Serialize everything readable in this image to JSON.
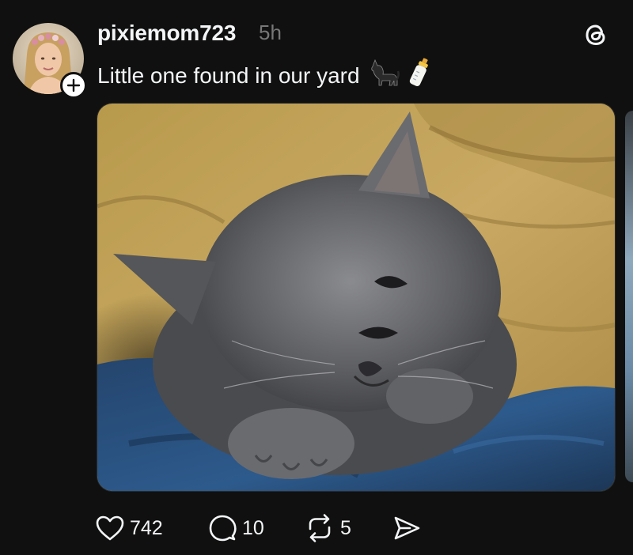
{
  "post": {
    "username": "pixiemom723",
    "timestamp": "5h",
    "caption": "Little one found in our yard",
    "caption_emoji": [
      "black-cat",
      "baby-bottle"
    ],
    "media_alt": "gray kitten under a mustard blanket on blue fabric"
  },
  "actions": {
    "likes": "742",
    "replies": "10",
    "reposts": "5"
  },
  "icons": {
    "like": "heart-icon",
    "reply": "comment-icon",
    "repost": "repost-icon",
    "share": "send-icon",
    "app": "threads-logo-icon",
    "follow": "plus-icon"
  },
  "colors": {
    "background": "#101010",
    "text": "#f3f5f7",
    "muted": "#777777"
  }
}
